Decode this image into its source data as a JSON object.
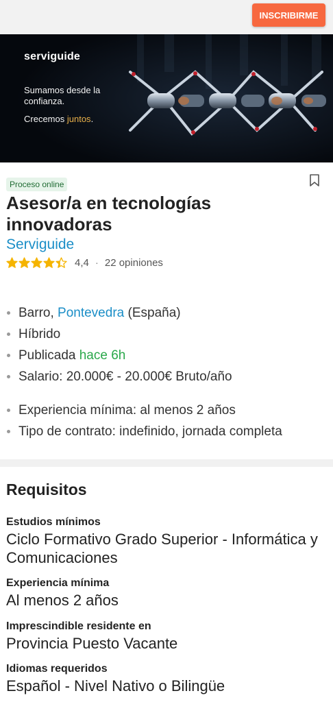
{
  "topbar": {
    "apply_label": "INSCRIBIRME"
  },
  "banner": {
    "brand": "serviguide",
    "tagline": "Sumamos desde la confianza.",
    "tagline2_prefix": "Crecemos ",
    "tagline2_accent": "juntos",
    "tagline2_suffix": "."
  },
  "job": {
    "badge": "Proceso online",
    "title": "Asesor/a en tecnologías innovadoras",
    "company": "Serviguide",
    "rating_value": "4,4",
    "rating_stars": 4.4,
    "reviews": "22 opiniones"
  },
  "facts": {
    "location_prefix": "Barro, ",
    "location_link": "Pontevedra",
    "location_suffix": " (España)",
    "modality": "Híbrido",
    "published_prefix": "Publicada ",
    "published_link": "hace 6h",
    "salary": "Salario: 20.000€ - 20.000€ Bruto/año",
    "experience": "Experiencia mínima: al menos 2 años",
    "contract": "Tipo de contrato: indefinido, jornada completa"
  },
  "requirements": {
    "title": "Requisitos",
    "items": [
      {
        "label": "Estudios mínimos",
        "value": "Ciclo Formativo Grado Superior - Informática y Comunicaciones"
      },
      {
        "label": "Experiencia mínima",
        "value": "Al menos 2 años"
      },
      {
        "label": "Imprescindible residente en",
        "value": "Provincia Puesto Vacante"
      },
      {
        "label": "Idiomas requeridos",
        "value": "Español - Nivel Nativo o Bilingüe"
      }
    ]
  },
  "colors": {
    "accent": "#f7683f",
    "link": "#1b8ec7",
    "green": "#2aa84a",
    "star": "#f5b400"
  },
  "icons": [
    "bookmark-icon",
    "star-icon",
    "bullet-icon"
  ]
}
